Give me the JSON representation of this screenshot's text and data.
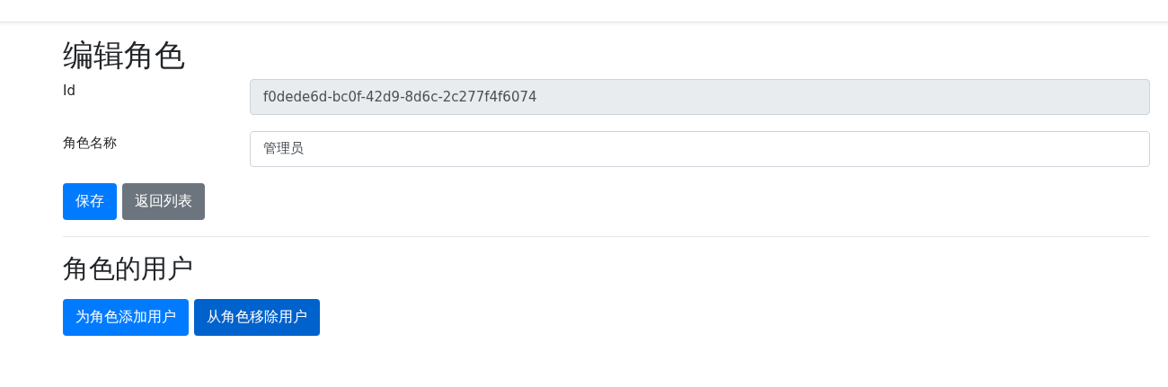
{
  "title": "编辑角色",
  "fields": [
    {
      "label": "Id",
      "value": "f0dede6d-bc0f-42d9-8d6c-2c277f4f6074",
      "disabled": true
    },
    {
      "label": "角色名称",
      "value": "管理员",
      "disabled": false
    }
  ],
  "form_buttons": [
    {
      "label": "保存",
      "kind": "primary"
    },
    {
      "label": "返回列表",
      "kind": "secondary"
    }
  ],
  "section_title": "角色的用户",
  "user_buttons": [
    {
      "label": "为角色添加用户",
      "hovered": false
    },
    {
      "label": "从角色移除用户",
      "hovered": true
    }
  ]
}
